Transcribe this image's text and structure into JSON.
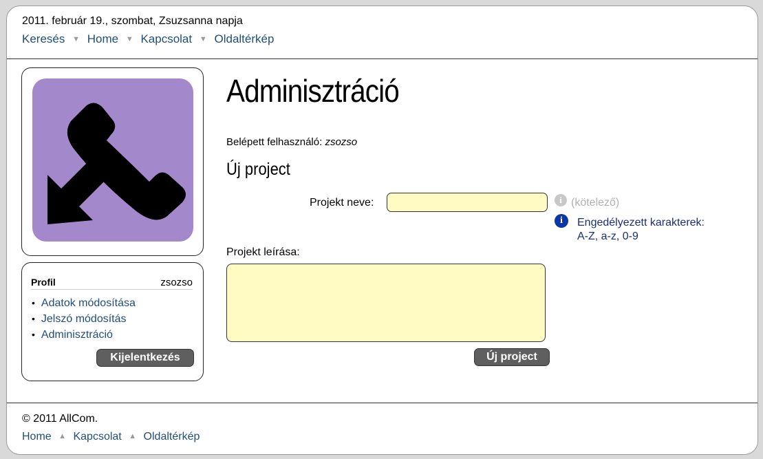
{
  "header": {
    "date": "2011. február 19., szombat, Zsuzsanna napja",
    "nav": [
      "Keresés",
      "Home",
      "Kapcsolat",
      "Oldaltérkép"
    ],
    "separator": "▼"
  },
  "profile": {
    "title": "Profil",
    "username": "zsozso",
    "links": [
      "Adatok módosítása",
      "Jelszó módosítás",
      "Adminisztráció"
    ],
    "logout_label": "Kijelentkezés"
  },
  "main": {
    "heading": "Adminisztráció",
    "logged_in_label": "Belépett felhasználó:",
    "logged_in_user": "zsozso",
    "subheading": "Új project",
    "project_name_label": "Projekt neve:",
    "project_name_value": "",
    "required_note": "(kötelező)",
    "allowed_line1": "Engedélyezett karakterek:",
    "allowed_line2": "A-Z, a-z, 0-9",
    "project_desc_label": "Projekt leírása:",
    "project_desc_value": "",
    "submit_label": "Új project"
  },
  "footer": {
    "copyright": "© 2011 AllCom.",
    "nav": [
      "Home",
      "Kapcsolat",
      "Oldaltérkép"
    ],
    "separator": "▲"
  },
  "colors": {
    "logo_bg": "#a389cc",
    "input_bg": "#fffbc2",
    "link": "#1f4e7a",
    "info_blue": "#0b36a8",
    "button_bg": "#5f5f5f"
  },
  "icons": {
    "logo": "phone-incoming-icon",
    "info_grey": "info-icon",
    "info_blue": "info-icon"
  }
}
